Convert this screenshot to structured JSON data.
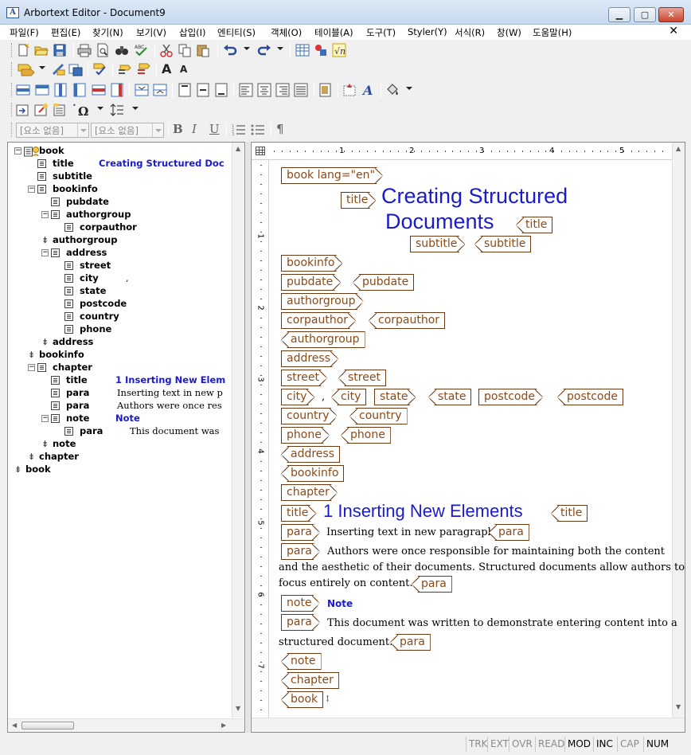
{
  "window": {
    "title": "Arbortext Editor - Document9",
    "app_icon": "A"
  },
  "menu": [
    "파일(F)",
    "편집(E)",
    "찾기(N)",
    "보기(V)",
    "삽입(I)",
    "엔티티(S)",
    "객체(O)",
    "테이블(A)",
    "도구(T)",
    "Styler(Y)",
    "서식(R)",
    "창(W)",
    "도움말(H)"
  ],
  "menu_close": "✕",
  "toolbar": {
    "element_combo_1": "[요소 없음]",
    "element_combo_2": "[요소 없음]",
    "bold": "B",
    "italic": "I",
    "underline": "U",
    "pilcrow": "¶",
    "font_up": "A",
    "font_down": "A"
  },
  "tree": [
    {
      "label": "book",
      "value": ""
    },
    {
      "label": "title",
      "value": "Creating Structured Doc"
    },
    {
      "label": "subtitle",
      "value": ""
    },
    {
      "label": "bookinfo",
      "value": ""
    },
    {
      "label": "pubdate",
      "value": ""
    },
    {
      "label": "authorgroup",
      "value": ""
    },
    {
      "label": "corpauthor",
      "value": ""
    },
    {
      "label": "authorgroup",
      "value": ""
    },
    {
      "label": "address",
      "value": ""
    },
    {
      "label": "street",
      "value": ""
    },
    {
      "label": "city",
      "value": ","
    },
    {
      "label": "state",
      "value": ""
    },
    {
      "label": "postcode",
      "value": ""
    },
    {
      "label": "country",
      "value": ""
    },
    {
      "label": "phone",
      "value": ""
    },
    {
      "label": "address",
      "value": ""
    },
    {
      "label": "bookinfo",
      "value": ""
    },
    {
      "label": "chapter",
      "value": ""
    },
    {
      "label": "title",
      "value": "1 Inserting New Elem"
    },
    {
      "label": "para",
      "value": "Inserting text in new p"
    },
    {
      "label": "para",
      "value": "Authors were once res"
    },
    {
      "label": "note",
      "value": "Note"
    },
    {
      "label": "para",
      "value": "This document was"
    },
    {
      "label": "note",
      "value": ""
    },
    {
      "label": "chapter",
      "value": ""
    },
    {
      "label": "book",
      "value": ""
    }
  ],
  "ruler": {
    "h_numbers": [
      "1",
      "2",
      "3",
      "4",
      "5"
    ],
    "v_numbers": [
      "1",
      "2",
      "3",
      "4",
      "5",
      "6",
      "7"
    ]
  },
  "doc": {
    "book_open": "book lang=\"en\"",
    "title_tag": "title",
    "title_line1": "Creating Structured",
    "title_line2": "Documents",
    "subtitle_tag": "subtitle",
    "bookinfo": "bookinfo",
    "pubdate": "pubdate",
    "authorgroup": "authorgroup",
    "corpauthor": "corpauthor",
    "address": "address",
    "street": "street",
    "city": "city",
    "city_comma": ",",
    "state": "state",
    "postcode": "postcode",
    "country": "country",
    "phone": "phone",
    "chapter": "chapter",
    "chapter_title": "1 Inserting New Elements",
    "para": "para",
    "para1_text": "Inserting text in new paragraph",
    "para2_line1": "Authors were once responsible for maintaining both the content",
    "para2_line2": "and the aesthetic of their documents. Structured documents allow authors to",
    "para2_line3": "focus entirely on content.",
    "note": "note",
    "note_label": "Note",
    "para3_line1": "This document was written to demonstrate entering content into a",
    "para3_line2": "structured document.",
    "book": "book"
  },
  "status": [
    "TRK",
    "EXT",
    "OVR",
    "READ",
    "MOD",
    "INC",
    "CAP",
    "NUM"
  ],
  "colors": {
    "tag_border": "#6b3a14",
    "tag_text": "#8a4a18",
    "heading_blue": "#1a1ad1"
  }
}
